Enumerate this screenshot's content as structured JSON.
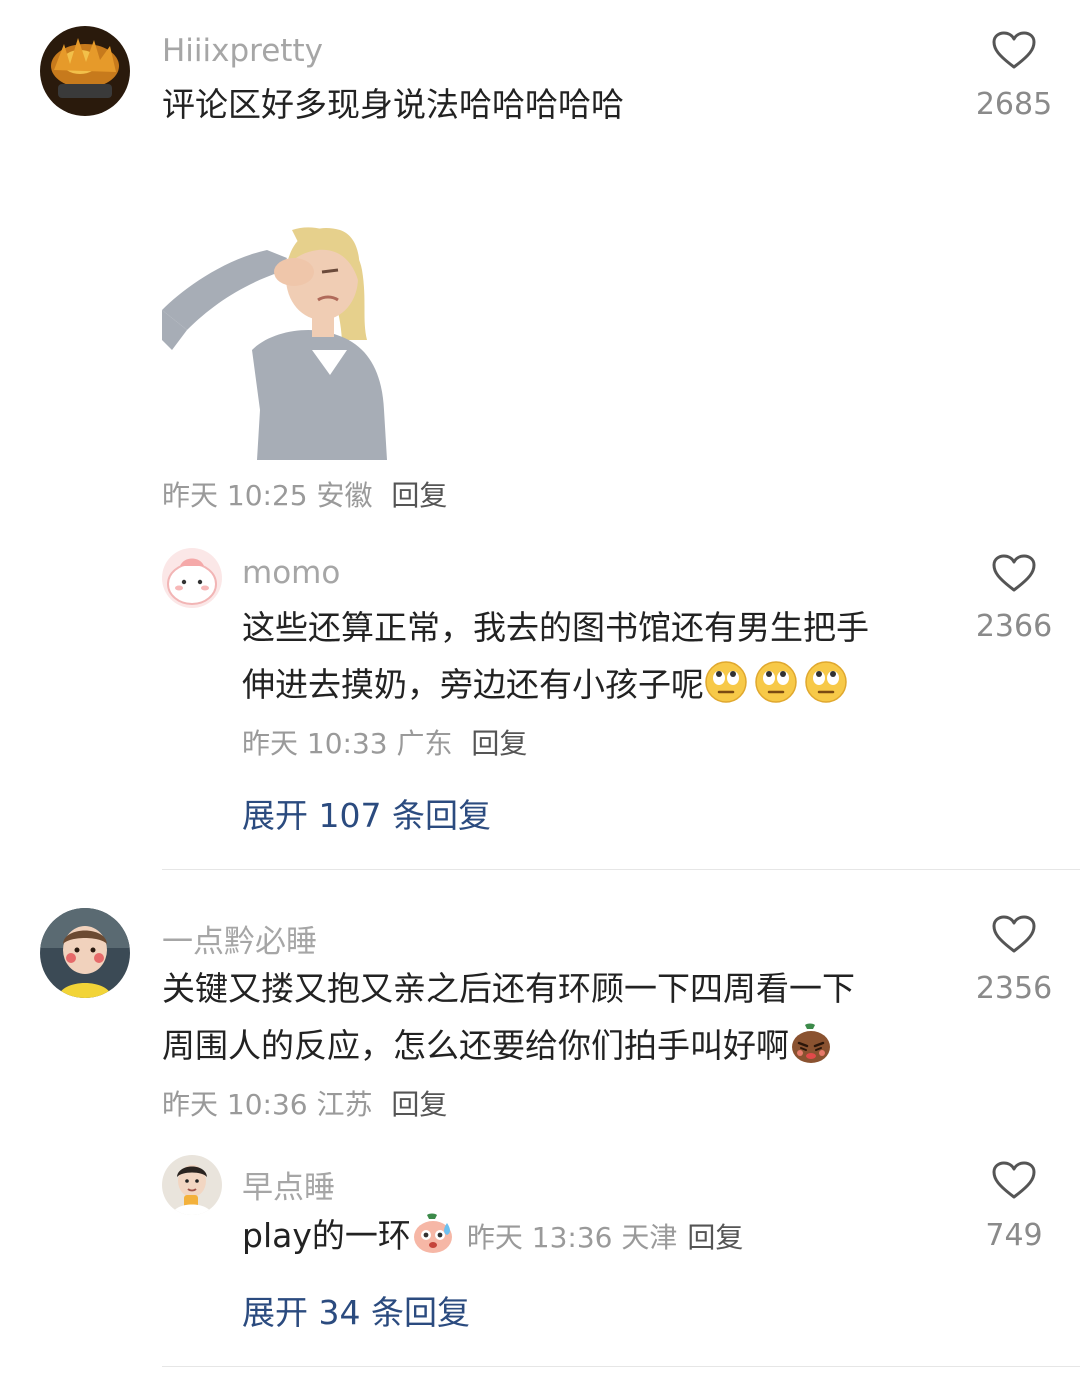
{
  "comments": [
    {
      "username": "Hiiixpretty",
      "content": "评论区好多现身说法哈哈哈哈哈",
      "time": "昨天 10:25",
      "location": "安徽",
      "reply_label": "回复",
      "likes": "2685",
      "reply": {
        "username": "momo",
        "content_line1": "这些还算正常，我去的图书馆还有男生把手",
        "content_line2": "伸进去摸奶，旁边还有小孩子呢",
        "time": "昨天 10:33",
        "location": "广东",
        "reply_label": "回复",
        "likes": "2366"
      },
      "expand_label": "展开 107 条回复"
    },
    {
      "username": "一点黔必睡",
      "content_line1": "关键又搂又抱又亲之后还有环顾一下四周看一下",
      "content_line2": "周围人的反应，怎么还要给你们拍手叫好啊",
      "time": "昨天 10:36",
      "location": "江苏",
      "reply_label": "回复",
      "likes": "2356",
      "reply": {
        "username": "早点睡",
        "content": "play的一环",
        "time": "昨天 13:36",
        "location": "天津",
        "reply_label": "回复",
        "likes": "749"
      },
      "expand_label": "展开 34 条回复"
    }
  ],
  "icons": [
    "heart-outline-icon",
    "eye-roll-emoji",
    "angry-doge-emoji",
    "sweat-emoji"
  ],
  "colors": {
    "link": "#2b4b7f",
    "muted": "#9a9a9a",
    "text": "#222222"
  }
}
